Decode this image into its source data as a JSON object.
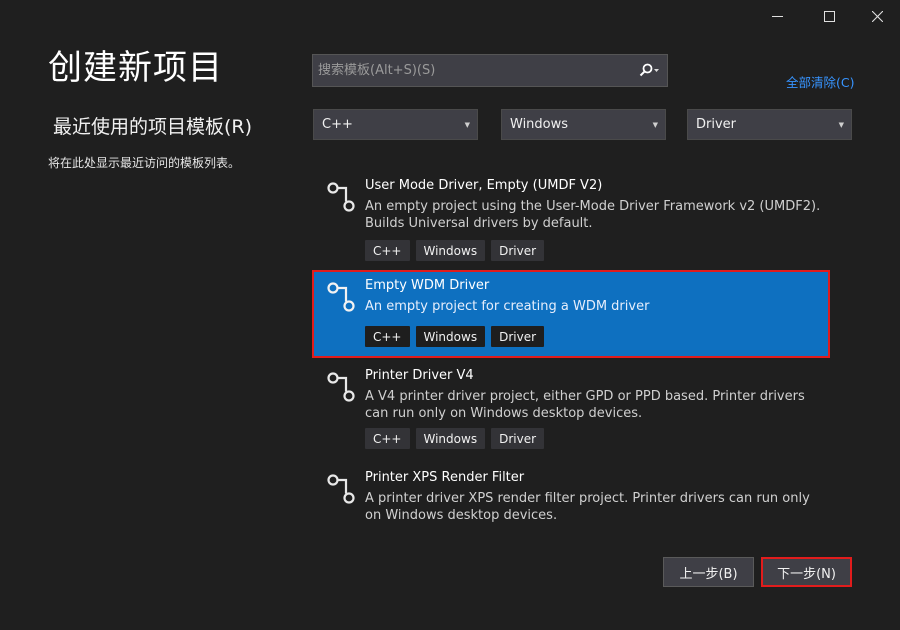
{
  "window": {
    "minimize_icon": "minimize-icon",
    "maximize_icon": "maximize-icon",
    "close_icon": "close-icon"
  },
  "header": {
    "title": "创建新项目"
  },
  "recent": {
    "title": "最近使用的项目模板(R)",
    "empty_text": "将在此处显示最近访问的模板列表。"
  },
  "search": {
    "placeholder": "搜索模板(Alt+S)(S)",
    "value": "",
    "icon": "search-icon"
  },
  "clear_all_label": "全部清除(C)",
  "filters": {
    "language": "C++",
    "platform": "Windows",
    "project_type": "Driver"
  },
  "templates": [
    {
      "name": "User Mode Driver, Empty (UMDF V2)",
      "description": "An empty project using the User-Mode Driver Framework v2 (UMDF2). Builds Universal drivers by default.",
      "tags": [
        "C++",
        "Windows",
        "Driver"
      ],
      "icon": "driver-icon"
    },
    {
      "name": "Empty WDM Driver",
      "description": "An empty project for creating a WDM driver",
      "tags": [
        "C++",
        "Windows",
        "Driver"
      ],
      "icon": "driver-icon",
      "selected": true
    },
    {
      "name": "Printer Driver V4",
      "description": "A V4 printer driver project, either GPD or PPD based. Printer drivers can run only on Windows desktop devices.",
      "tags": [
        "C++",
        "Windows",
        "Driver"
      ],
      "icon": "driver-icon"
    },
    {
      "name": "Printer XPS Render Filter",
      "description": "A printer driver XPS render filter project. Printer drivers can run only on Windows desktop devices.",
      "tags": [],
      "icon": "driver-icon"
    }
  ],
  "footer": {
    "back_label": "上一步(B)",
    "next_label": "下一步(N)"
  },
  "colors": {
    "background": "#1f1f1f",
    "selection": "#0e70c0",
    "highlight_border": "#e11c1c",
    "link": "#3794ff"
  }
}
